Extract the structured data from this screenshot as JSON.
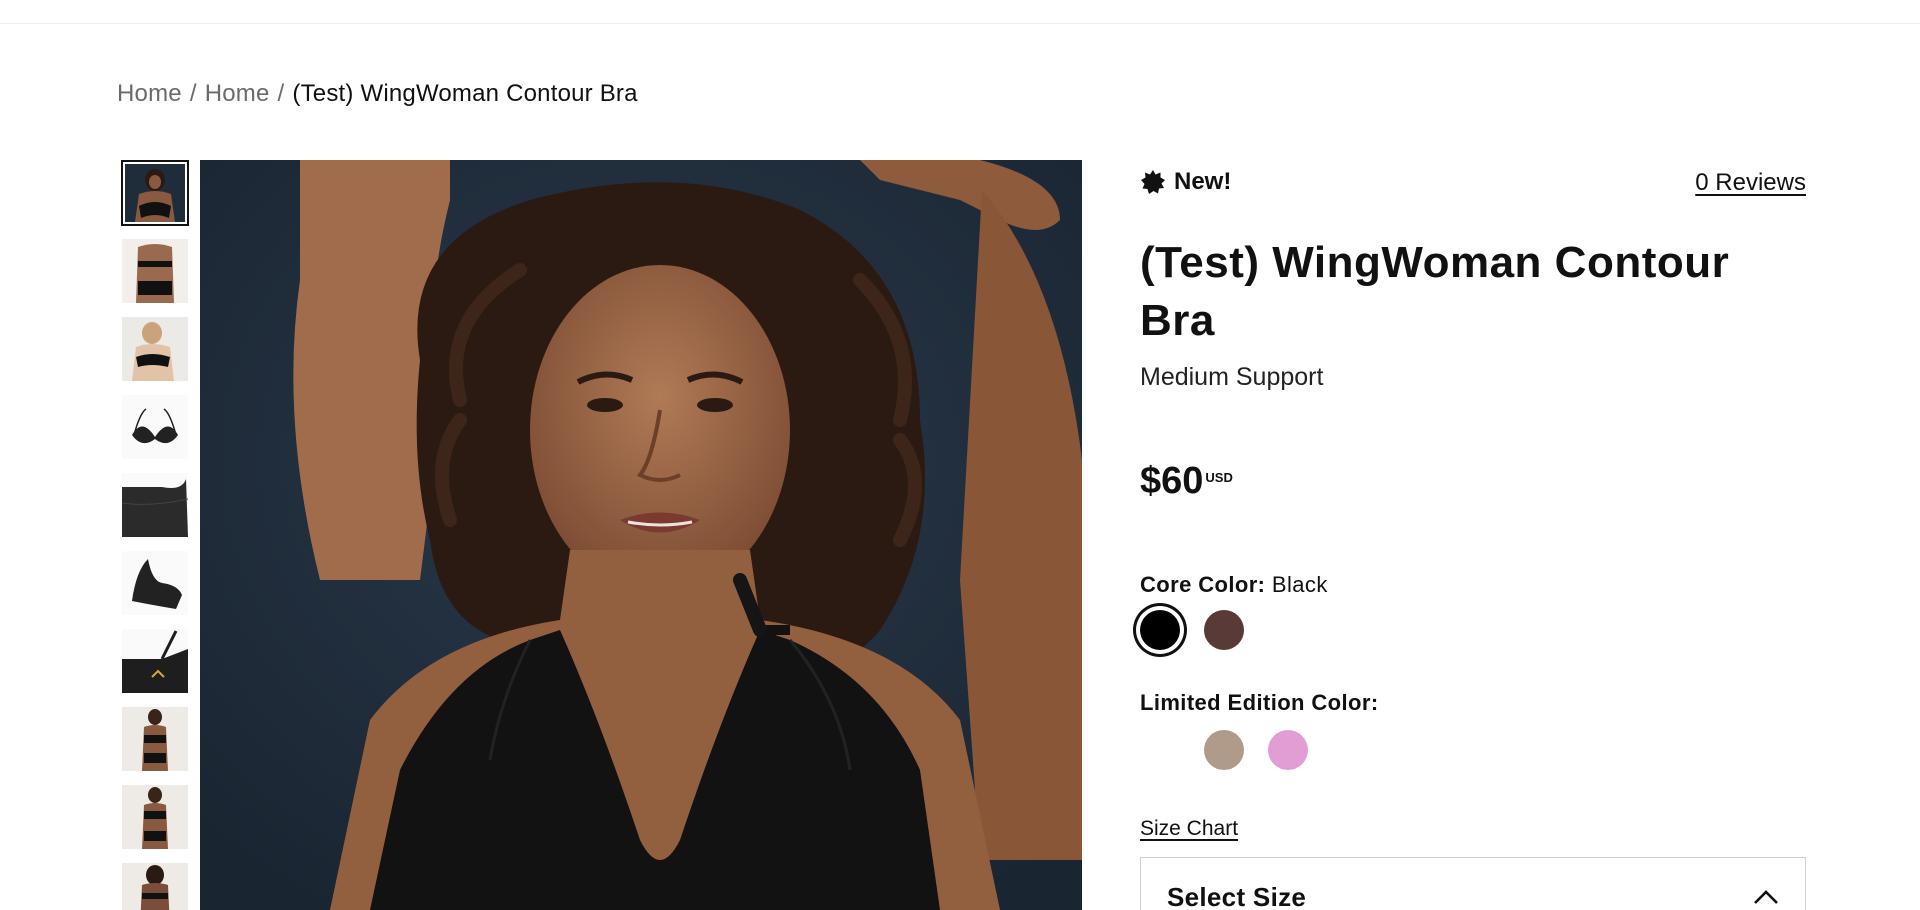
{
  "breadcrumb": {
    "items": [
      "Home",
      "Home"
    ],
    "separator": "/",
    "current": "(Test) WingWoman Contour Bra"
  },
  "gallery": {
    "thumbnail_count": 10,
    "active_index": 0
  },
  "product": {
    "badge": "New!",
    "reviews_link": "0 Reviews",
    "title": "(Test) WingWoman Contour Bra",
    "subtitle": "Medium Support",
    "price": "$60",
    "currency": "USD"
  },
  "core_color": {
    "label": "Core Color:",
    "selected_value": "Black",
    "swatches": [
      {
        "name": "Black",
        "color": "#000000",
        "selected": true
      },
      {
        "name": "Brown",
        "color": "#5a3a36",
        "selected": false
      }
    ]
  },
  "limited_color": {
    "label": "Limited Edition Color:",
    "swatches": [
      {
        "name": "",
        "color": "transparent"
      },
      {
        "name": "Taupe",
        "color": "#b09a89"
      },
      {
        "name": "Pink",
        "color": "#e29ed4"
      }
    ]
  },
  "size": {
    "chart_link": "Size Chart",
    "select_label": "Select Size",
    "expanded": true
  },
  "icons": {
    "badge_icon": "starburst-icon",
    "select_icon": "chevron-up-icon"
  }
}
